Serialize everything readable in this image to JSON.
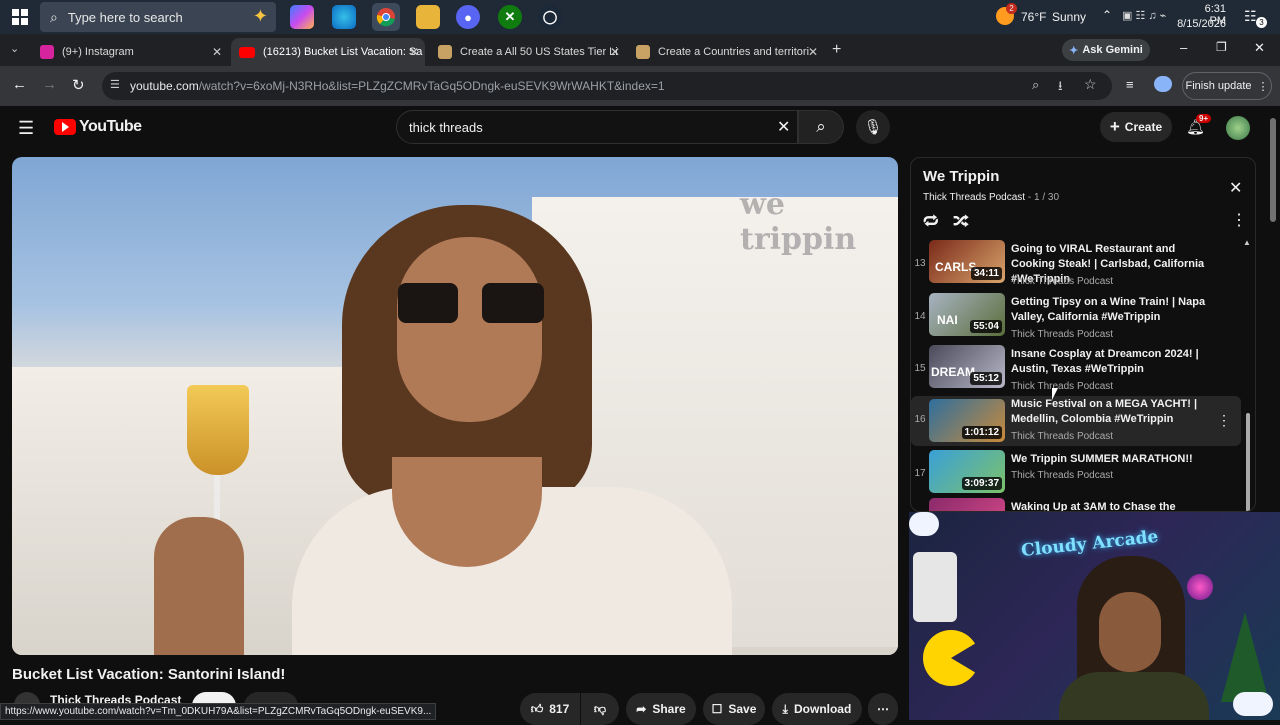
{
  "taskbar": {
    "search_placeholder": "Type here to search",
    "weather_temp": "76°F",
    "weather_desc": "Sunny",
    "weather_badge": "2",
    "time": "6:31 PM",
    "date": "8/15/2026",
    "notif_count": "3"
  },
  "tabs": [
    {
      "title": "(9+) Instagram",
      "color": "#d6249f"
    },
    {
      "title": "(16213) Bucket List Vacation: Sa",
      "color": "#ff0000"
    },
    {
      "title": "Create a All 50 US States Tier Li",
      "color": "#c8a165"
    },
    {
      "title": "Create a Countries and territori",
      "color": "#c8a165"
    }
  ],
  "browser": {
    "ask_gemini": "Ask Gemini",
    "finish_update": "Finish update",
    "url_host": "youtube.com",
    "url_path": "/watch?v=6xoMj-N3RHo&list=PLZgZCMRvTaGq5ODngk-euSEVK9WrWAHKT&index=1"
  },
  "youtube": {
    "logo": "YouTube",
    "search_value": "thick threads",
    "create_label": "Create",
    "notif_badge": "9+"
  },
  "video": {
    "title": "Bucket List Vacation: Santorini Island!",
    "channel": "Thick Threads Podcast",
    "likes": "817",
    "share": "Share",
    "save": "Save",
    "download": "Download",
    "watermark": "we trippin"
  },
  "playlist": {
    "title": "We Trippin",
    "channel": "Thick Threads Podcast",
    "position": "1 / 30",
    "items": [
      {
        "num": "13",
        "title": "Going to VIRAL Restaurant and Cooking Steak! | Carlsbad, California #WeTrippin",
        "channel": "Thick Threads Podcast",
        "duration": "34:11",
        "thumb_text": "CARLS",
        "c1": "#7a2a1a",
        "c2": "#d9a46b"
      },
      {
        "num": "14",
        "title": "Getting Tipsy on a Wine Train! | Napa Valley, California #WeTrippin",
        "channel": "Thick Threads Podcast",
        "duration": "55:04",
        "thumb_text": "NAI",
        "c1": "#a8b3c2",
        "c2": "#5a6e3a"
      },
      {
        "num": "15",
        "title": "Insane Cosplay at Dreamcon 2024! | Austin, Texas #WeTrippin",
        "channel": "Thick Threads Podcast",
        "duration": "55:12",
        "thumb_text": "DREAM",
        "c1": "#4a4a5a",
        "c2": "#b8b8c8"
      },
      {
        "num": "16",
        "title": "Music Festival on a MEGA YACHT! | Medellin, Colombia #WeTrippin",
        "channel": "Thick Threads Podcast",
        "duration": "1:01:12",
        "thumb_text": "",
        "c1": "#2e6f9e",
        "c2": "#c98a3a"
      },
      {
        "num": "17",
        "title": "We Trippin SUMMER MARATHON!!",
        "channel": "Thick Threads Podcast",
        "duration": "3:09:37",
        "thumb_text": "",
        "c1": "#3aa0d8",
        "c2": "#7cc26a"
      },
      {
        "num": "",
        "title": "Waking Up at 3AM to Chase the",
        "channel": "",
        "duration": "",
        "thumb_text": "",
        "c1": "#8a2a6a",
        "c2": "#d84a8a"
      }
    ]
  },
  "webcam": {
    "sign": "Cloudy Arcade"
  },
  "status_url": "https://www.youtube.com/watch?v=Tm_0DKUH79A&list=PLZgZCMRvTaGq5ODngk-euSEVK9..."
}
